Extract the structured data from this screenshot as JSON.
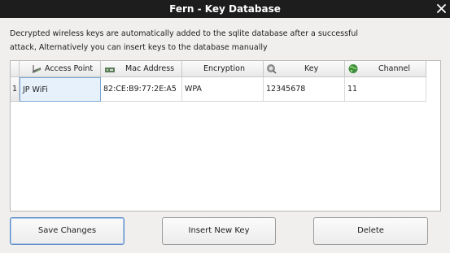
{
  "window": {
    "title": "Fern - Key Database",
    "close_glyph": "close-icon"
  },
  "description": {
    "line1": "Decrypted wireless keys are automatically added to the sqlite database after a successful",
    "line2": "attack, Alternatively you can insert keys to the database manually"
  },
  "table": {
    "columns": [
      {
        "label": "Access Point",
        "icon": "access-point-icon"
      },
      {
        "label": "Mac Address",
        "icon": "network-card-icon"
      },
      {
        "label": "Encryption",
        "icon": ""
      },
      {
        "label": "Key",
        "icon": "key-icon"
      },
      {
        "label": "Channel",
        "icon": "globe-icon"
      }
    ],
    "rows": [
      {
        "number": "1",
        "cells": [
          "JP WiFi",
          "82:CE:B9:77:2E:A5",
          "WPA",
          "12345678",
          "11"
        ]
      }
    ]
  },
  "buttons": {
    "save": "Save Changes",
    "insert": "Insert New Key",
    "delete": "Delete"
  },
  "colors": {
    "titlebar": "#1d1d1d",
    "selection": "#e6f1fb",
    "focus_border": "#5b8bc7"
  }
}
